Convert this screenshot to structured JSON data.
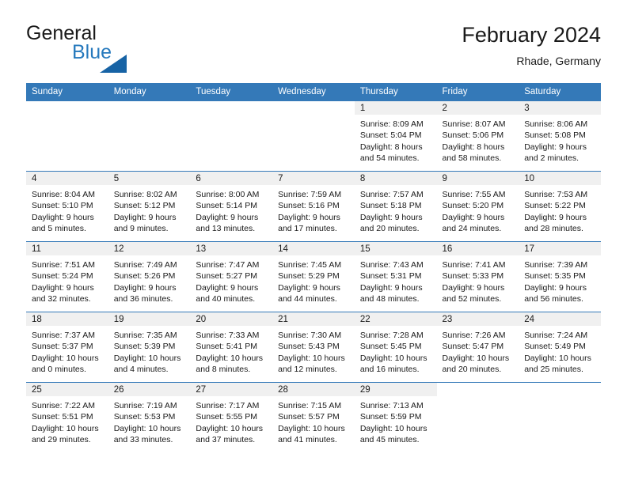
{
  "brand": {
    "line1": "General",
    "line2": "Blue",
    "logo_color": "#1763a5",
    "accent_color": "#2679bd"
  },
  "header": {
    "title": "February 2024",
    "subtitle": "Rhade, Germany",
    "header_bg": "#3479b8"
  },
  "weekday_headers": [
    "Sunday",
    "Monday",
    "Tuesday",
    "Wednesday",
    "Thursday",
    "Friday",
    "Saturday"
  ],
  "labels": {
    "sunrise_prefix": "Sunrise:",
    "sunset_prefix": "Sunset:",
    "daylight_prefix": "Daylight:"
  },
  "weeks": [
    [
      {
        "day": "",
        "sunrise": "",
        "sunset": "",
        "daylight_line1": "",
        "daylight_line2": "",
        "blank": true
      },
      {
        "day": "",
        "sunrise": "",
        "sunset": "",
        "daylight_line1": "",
        "daylight_line2": "",
        "blank": true
      },
      {
        "day": "",
        "sunrise": "",
        "sunset": "",
        "daylight_line1": "",
        "daylight_line2": "",
        "blank": true
      },
      {
        "day": "",
        "sunrise": "",
        "sunset": "",
        "daylight_line1": "",
        "daylight_line2": "",
        "blank": true
      },
      {
        "day": "1",
        "sunrise": "Sunrise: 8:09 AM",
        "sunset": "Sunset: 5:04 PM",
        "daylight_line1": "Daylight: 8 hours",
        "daylight_line2": "and 54 minutes.",
        "blank": false
      },
      {
        "day": "2",
        "sunrise": "Sunrise: 8:07 AM",
        "sunset": "Sunset: 5:06 PM",
        "daylight_line1": "Daylight: 8 hours",
        "daylight_line2": "and 58 minutes.",
        "blank": false
      },
      {
        "day": "3",
        "sunrise": "Sunrise: 8:06 AM",
        "sunset": "Sunset: 5:08 PM",
        "daylight_line1": "Daylight: 9 hours",
        "daylight_line2": "and 2 minutes.",
        "blank": false
      }
    ],
    [
      {
        "day": "4",
        "sunrise": "Sunrise: 8:04 AM",
        "sunset": "Sunset: 5:10 PM",
        "daylight_line1": "Daylight: 9 hours",
        "daylight_line2": "and 5 minutes.",
        "blank": false
      },
      {
        "day": "5",
        "sunrise": "Sunrise: 8:02 AM",
        "sunset": "Sunset: 5:12 PM",
        "daylight_line1": "Daylight: 9 hours",
        "daylight_line2": "and 9 minutes.",
        "blank": false
      },
      {
        "day": "6",
        "sunrise": "Sunrise: 8:00 AM",
        "sunset": "Sunset: 5:14 PM",
        "daylight_line1": "Daylight: 9 hours",
        "daylight_line2": "and 13 minutes.",
        "blank": false
      },
      {
        "day": "7",
        "sunrise": "Sunrise: 7:59 AM",
        "sunset": "Sunset: 5:16 PM",
        "daylight_line1": "Daylight: 9 hours",
        "daylight_line2": "and 17 minutes.",
        "blank": false
      },
      {
        "day": "8",
        "sunrise": "Sunrise: 7:57 AM",
        "sunset": "Sunset: 5:18 PM",
        "daylight_line1": "Daylight: 9 hours",
        "daylight_line2": "and 20 minutes.",
        "blank": false
      },
      {
        "day": "9",
        "sunrise": "Sunrise: 7:55 AM",
        "sunset": "Sunset: 5:20 PM",
        "daylight_line1": "Daylight: 9 hours",
        "daylight_line2": "and 24 minutes.",
        "blank": false
      },
      {
        "day": "10",
        "sunrise": "Sunrise: 7:53 AM",
        "sunset": "Sunset: 5:22 PM",
        "daylight_line1": "Daylight: 9 hours",
        "daylight_line2": "and 28 minutes.",
        "blank": false
      }
    ],
    [
      {
        "day": "11",
        "sunrise": "Sunrise: 7:51 AM",
        "sunset": "Sunset: 5:24 PM",
        "daylight_line1": "Daylight: 9 hours",
        "daylight_line2": "and 32 minutes.",
        "blank": false
      },
      {
        "day": "12",
        "sunrise": "Sunrise: 7:49 AM",
        "sunset": "Sunset: 5:26 PM",
        "daylight_line1": "Daylight: 9 hours",
        "daylight_line2": "and 36 minutes.",
        "blank": false
      },
      {
        "day": "13",
        "sunrise": "Sunrise: 7:47 AM",
        "sunset": "Sunset: 5:27 PM",
        "daylight_line1": "Daylight: 9 hours",
        "daylight_line2": "and 40 minutes.",
        "blank": false
      },
      {
        "day": "14",
        "sunrise": "Sunrise: 7:45 AM",
        "sunset": "Sunset: 5:29 PM",
        "daylight_line1": "Daylight: 9 hours",
        "daylight_line2": "and 44 minutes.",
        "blank": false
      },
      {
        "day": "15",
        "sunrise": "Sunrise: 7:43 AM",
        "sunset": "Sunset: 5:31 PM",
        "daylight_line1": "Daylight: 9 hours",
        "daylight_line2": "and 48 minutes.",
        "blank": false
      },
      {
        "day": "16",
        "sunrise": "Sunrise: 7:41 AM",
        "sunset": "Sunset: 5:33 PM",
        "daylight_line1": "Daylight: 9 hours",
        "daylight_line2": "and 52 minutes.",
        "blank": false
      },
      {
        "day": "17",
        "sunrise": "Sunrise: 7:39 AM",
        "sunset": "Sunset: 5:35 PM",
        "daylight_line1": "Daylight: 9 hours",
        "daylight_line2": "and 56 minutes.",
        "blank": false
      }
    ],
    [
      {
        "day": "18",
        "sunrise": "Sunrise: 7:37 AM",
        "sunset": "Sunset: 5:37 PM",
        "daylight_line1": "Daylight: 10 hours",
        "daylight_line2": "and 0 minutes.",
        "blank": false
      },
      {
        "day": "19",
        "sunrise": "Sunrise: 7:35 AM",
        "sunset": "Sunset: 5:39 PM",
        "daylight_line1": "Daylight: 10 hours",
        "daylight_line2": "and 4 minutes.",
        "blank": false
      },
      {
        "day": "20",
        "sunrise": "Sunrise: 7:33 AM",
        "sunset": "Sunset: 5:41 PM",
        "daylight_line1": "Daylight: 10 hours",
        "daylight_line2": "and 8 minutes.",
        "blank": false
      },
      {
        "day": "21",
        "sunrise": "Sunrise: 7:30 AM",
        "sunset": "Sunset: 5:43 PM",
        "daylight_line1": "Daylight: 10 hours",
        "daylight_line2": "and 12 minutes.",
        "blank": false
      },
      {
        "day": "22",
        "sunrise": "Sunrise: 7:28 AM",
        "sunset": "Sunset: 5:45 PM",
        "daylight_line1": "Daylight: 10 hours",
        "daylight_line2": "and 16 minutes.",
        "blank": false
      },
      {
        "day": "23",
        "sunrise": "Sunrise: 7:26 AM",
        "sunset": "Sunset: 5:47 PM",
        "daylight_line1": "Daylight: 10 hours",
        "daylight_line2": "and 20 minutes.",
        "blank": false
      },
      {
        "day": "24",
        "sunrise": "Sunrise: 7:24 AM",
        "sunset": "Sunset: 5:49 PM",
        "daylight_line1": "Daylight: 10 hours",
        "daylight_line2": "and 25 minutes.",
        "blank": false
      }
    ],
    [
      {
        "day": "25",
        "sunrise": "Sunrise: 7:22 AM",
        "sunset": "Sunset: 5:51 PM",
        "daylight_line1": "Daylight: 10 hours",
        "daylight_line2": "and 29 minutes.",
        "blank": false
      },
      {
        "day": "26",
        "sunrise": "Sunrise: 7:19 AM",
        "sunset": "Sunset: 5:53 PM",
        "daylight_line1": "Daylight: 10 hours",
        "daylight_line2": "and 33 minutes.",
        "blank": false
      },
      {
        "day": "27",
        "sunrise": "Sunrise: 7:17 AM",
        "sunset": "Sunset: 5:55 PM",
        "daylight_line1": "Daylight: 10 hours",
        "daylight_line2": "and 37 minutes.",
        "blank": false
      },
      {
        "day": "28",
        "sunrise": "Sunrise: 7:15 AM",
        "sunset": "Sunset: 5:57 PM",
        "daylight_line1": "Daylight: 10 hours",
        "daylight_line2": "and 41 minutes.",
        "blank": false
      },
      {
        "day": "29",
        "sunrise": "Sunrise: 7:13 AM",
        "sunset": "Sunset: 5:59 PM",
        "daylight_line1": "Daylight: 10 hours",
        "daylight_line2": "and 45 minutes.",
        "blank": false
      },
      {
        "day": "",
        "sunrise": "",
        "sunset": "",
        "daylight_line1": "",
        "daylight_line2": "",
        "blank": true
      },
      {
        "day": "",
        "sunrise": "",
        "sunset": "",
        "daylight_line1": "",
        "daylight_line2": "",
        "blank": true
      }
    ]
  ]
}
